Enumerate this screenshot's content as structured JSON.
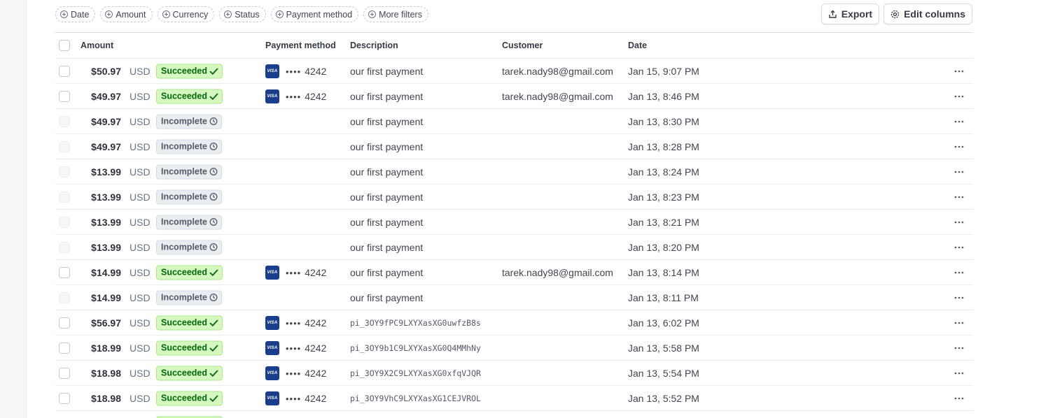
{
  "filters": [
    "Date",
    "Amount",
    "Currency",
    "Status",
    "Payment method",
    "More filters"
  ],
  "actions": {
    "export_label": "Export",
    "edit_columns_label": "Edit columns"
  },
  "columns": {
    "amount": "Amount",
    "payment_method": "Payment method",
    "description": "Description",
    "customer": "Customer",
    "date": "Date"
  },
  "colors": {
    "succeeded_bg": "#d7f7c2",
    "succeeded_text": "#006908",
    "incomplete_bg": "#ebeef1",
    "visa_blue": "#1a3e8b"
  },
  "card_brand_text": "VISA",
  "card_dots": "••••",
  "rows": [
    {
      "amount": "$50.97",
      "currency": "USD",
      "status": "Succeeded",
      "card_last4": "4242",
      "description": "our first payment",
      "customer": "tarek.nady98@gmail.com",
      "date": "Jan 15, 9:07 PM"
    },
    {
      "amount": "$49.97",
      "currency": "USD",
      "status": "Succeeded",
      "card_last4": "4242",
      "description": "our first payment",
      "customer": "tarek.nady98@gmail.com",
      "date": "Jan 13, 8:46 PM"
    },
    {
      "amount": "$49.97",
      "currency": "USD",
      "status": "Incomplete",
      "card_last4": "",
      "description": "our first payment",
      "customer": "",
      "date": "Jan 13, 8:30 PM"
    },
    {
      "amount": "$49.97",
      "currency": "USD",
      "status": "Incomplete",
      "card_last4": "",
      "description": "our first payment",
      "customer": "",
      "date": "Jan 13, 8:28 PM"
    },
    {
      "amount": "$13.99",
      "currency": "USD",
      "status": "Incomplete",
      "card_last4": "",
      "description": "our first payment",
      "customer": "",
      "date": "Jan 13, 8:24 PM"
    },
    {
      "amount": "$13.99",
      "currency": "USD",
      "status": "Incomplete",
      "card_last4": "",
      "description": "our first payment",
      "customer": "",
      "date": "Jan 13, 8:23 PM"
    },
    {
      "amount": "$13.99",
      "currency": "USD",
      "status": "Incomplete",
      "card_last4": "",
      "description": "our first payment",
      "customer": "",
      "date": "Jan 13, 8:21 PM"
    },
    {
      "amount": "$13.99",
      "currency": "USD",
      "status": "Incomplete",
      "card_last4": "",
      "description": "our first payment",
      "customer": "",
      "date": "Jan 13, 8:20 PM"
    },
    {
      "amount": "$14.99",
      "currency": "USD",
      "status": "Succeeded",
      "card_last4": "4242",
      "description": "our first payment",
      "customer": "tarek.nady98@gmail.com",
      "date": "Jan 13, 8:14 PM"
    },
    {
      "amount": "$14.99",
      "currency": "USD",
      "status": "Incomplete",
      "card_last4": "",
      "description": "our first payment",
      "customer": "",
      "date": "Jan 13, 8:11 PM"
    },
    {
      "amount": "$56.97",
      "currency": "USD",
      "status": "Succeeded",
      "card_last4": "4242",
      "description": "pi_3OY9fPC9LXYXasXG0uwfzB8s",
      "customer": "",
      "date": "Jan 13, 6:02 PM"
    },
    {
      "amount": "$18.99",
      "currency": "USD",
      "status": "Succeeded",
      "card_last4": "4242",
      "description": "pi_3OY9b1C9LXYXasXG0Q4MMhNy",
      "customer": "",
      "date": "Jan 13, 5:58 PM"
    },
    {
      "amount": "$18.98",
      "currency": "USD",
      "status": "Succeeded",
      "card_last4": "4242",
      "description": "pi_3OY9X2C9LXYXasXG0xfqVJQR",
      "customer": "",
      "date": "Jan 13, 5:54 PM"
    },
    {
      "amount": "$18.98",
      "currency": "USD",
      "status": "Succeeded",
      "card_last4": "4242",
      "description": "pi_3OY9VhC9LXYXasXG1CEJVROL",
      "customer": "",
      "date": "Jan 13, 5:52 PM"
    },
    {
      "amount": "",
      "currency": "",
      "status": "Succeeded",
      "card_last4": "",
      "description": "",
      "customer": "",
      "date": ""
    }
  ]
}
